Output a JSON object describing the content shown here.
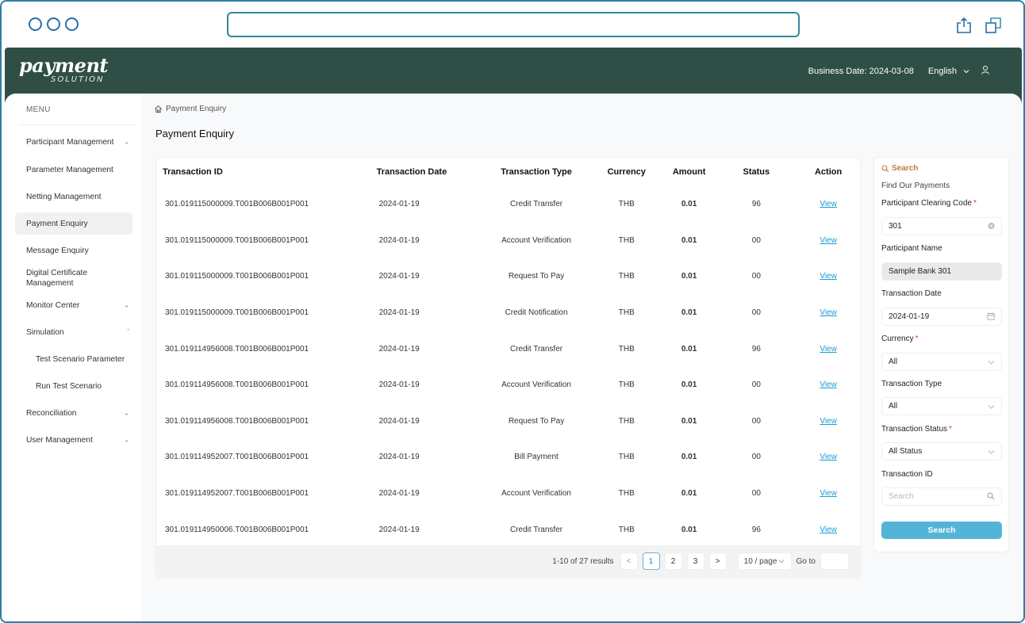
{
  "browser": {
    "address": "",
    "icons": [
      "share-icon",
      "new-window-icon"
    ]
  },
  "header": {
    "logo_main": "payment",
    "logo_sub": "SOLUTION",
    "business_date": "Business Date: 2024-03-08",
    "language": "English",
    "brand_color": "#2f4f46"
  },
  "sidebar": {
    "menu_title": "MENU",
    "items": [
      {
        "label": "Participant Management",
        "chevron": "down"
      },
      {
        "label": "Parameter Management"
      },
      {
        "label": "Netting Management"
      },
      {
        "label": "Payment Enquiry",
        "active": true
      },
      {
        "label": "Message Enquiry"
      },
      {
        "label": "Digital Certificate Management"
      },
      {
        "label": "Monitor Center",
        "chevron": "down"
      },
      {
        "label": "Simulation",
        "chevron": "up"
      },
      {
        "label": "Test Scenario Parameter",
        "sub": true
      },
      {
        "label": "Run Test Scenario",
        "sub": true
      },
      {
        "label": "Reconciliation",
        "chevron": "down"
      },
      {
        "label": "User Management",
        "chevron": "down"
      }
    ]
  },
  "breadcrumb": {
    "label": "Payment Enquiry"
  },
  "page_title": "Payment Enquiry",
  "table": {
    "columns": [
      "Transaction ID",
      "Transaction Date",
      "Transaction Type",
      "Currency",
      "Amount",
      "Status",
      "Action"
    ],
    "rows": [
      {
        "id": "301.019115000009.T001B006B001P001",
        "date": "2024-01-19",
        "type": "Credit Transfer",
        "currency": "THB",
        "amount": "0.01",
        "status": "96",
        "action": "View"
      },
      {
        "id": "301.019115000009.T001B006B001P001",
        "date": "2024-01-19",
        "type": "Account Verification",
        "currency": "THB",
        "amount": "0.01",
        "status": "00",
        "action": "View"
      },
      {
        "id": "301.019115000009.T001B006B001P001",
        "date": "2024-01-19",
        "type": "Request To Pay",
        "currency": "THB",
        "amount": "0.01",
        "status": "00",
        "action": "View"
      },
      {
        "id": "301.019115000009.T001B006B001P001",
        "date": "2024-01-19",
        "type": "Credit Notification",
        "currency": "THB",
        "amount": "0.01",
        "status": "00",
        "action": "View"
      },
      {
        "id": "301.019114956008.T001B006B001P001",
        "date": "2024-01-19",
        "type": "Credit Transfer",
        "currency": "THB",
        "amount": "0.01",
        "status": "96",
        "action": "View"
      },
      {
        "id": "301.019114956008.T001B006B001P001",
        "date": "2024-01-19",
        "type": "Account Verification",
        "currency": "THB",
        "amount": "0.01",
        "status": "00",
        "action": "View"
      },
      {
        "id": "301.019114956008.T001B006B001P001",
        "date": "2024-01-19",
        "type": "Request To Pay",
        "currency": "THB",
        "amount": "0.01",
        "status": "00",
        "action": "View"
      },
      {
        "id": "301.019114952007.T001B006B001P001",
        "date": "2024-01-19",
        "type": "Bill Payment",
        "currency": "THB",
        "amount": "0.01",
        "status": "00",
        "action": "View"
      },
      {
        "id": "301.019114952007.T001B006B001P001",
        "date": "2024-01-19",
        "type": "Account Verification",
        "currency": "THB",
        "amount": "0.01",
        "status": "00",
        "action": "View"
      },
      {
        "id": "301.019114950006.T001B006B001P001",
        "date": "2024-01-19",
        "type": "Credit Transfer",
        "currency": "THB",
        "amount": "0.01",
        "status": "96",
        "action": "View"
      }
    ]
  },
  "pagination": {
    "results": "1-10 of 27 results",
    "pages": [
      "1",
      "2",
      "3"
    ],
    "current_page": "1",
    "prev": "<",
    "next": ">",
    "page_size": "10 / page",
    "goto_label": "Go to",
    "goto_value": ""
  },
  "search_panel": {
    "title": "Search",
    "subtitle": "Find Our Payments",
    "fields": {
      "clearing_code": {
        "label": "Participant Clearing Code",
        "required": true,
        "value": "301"
      },
      "participant_name": {
        "label": "Participant Name",
        "value": "Sample Bank 301"
      },
      "transaction_date": {
        "label": "Transaction Date",
        "value": "2024-01-19"
      },
      "currency": {
        "label": "Currency",
        "required": true,
        "value": "All"
      },
      "transaction_type": {
        "label": "Transaction Type",
        "value": "All"
      },
      "transaction_status": {
        "label": "Transaction Status",
        "required": true,
        "value": "All Status"
      },
      "transaction_id": {
        "label": "Transaction ID",
        "placeholder": "Search",
        "value": ""
      }
    },
    "button_label": "Search",
    "accent_color": "#54b4d8",
    "title_color": "#c07a3a"
  }
}
